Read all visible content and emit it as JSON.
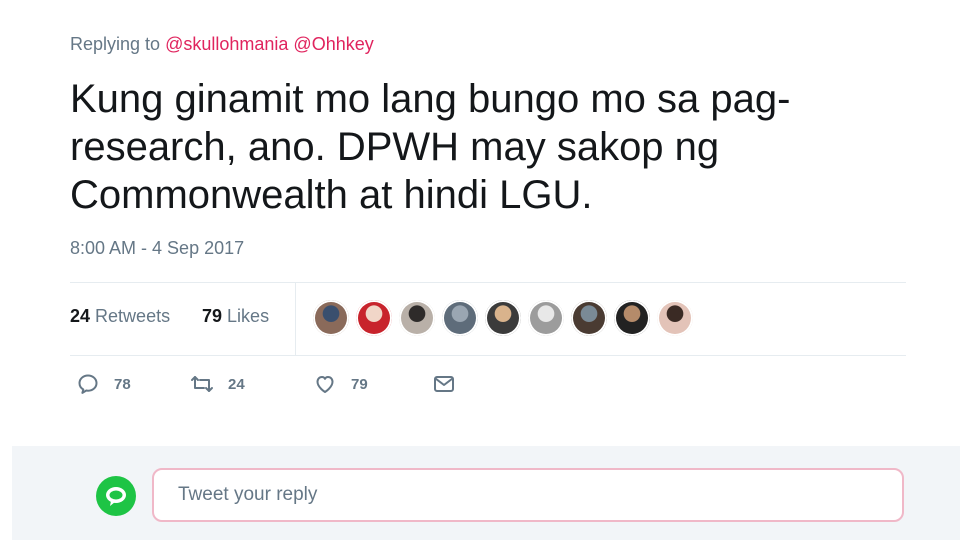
{
  "reply_context": {
    "prefix": "Replying to",
    "handles": [
      "@skullohmania",
      "@Ohhkey"
    ]
  },
  "tweet": {
    "text": "Kung ginamit mo lang bungo mo sa pag-\nresearch, ano. DPWH may sakop ng\nCommonwealth at hindi LGU.",
    "timestamp": "8:00 AM - 4 Sep 2017"
  },
  "stats": {
    "retweets_count": "24",
    "retweets_label": "Retweets",
    "likes_count": "79",
    "likes_label": "Likes"
  },
  "likers": [
    {
      "color": "#8a6a5a",
      "accent": "#3a4f6e"
    },
    {
      "color": "#c8232c",
      "accent": "#f1d6c8"
    },
    {
      "color": "#b9b0a8",
      "accent": "#2e2b2a"
    },
    {
      "color": "#5e6c7a",
      "accent": "#9aa6b2"
    },
    {
      "color": "#3b3b3b",
      "accent": "#d9b38c"
    },
    {
      "color": "#9c9c9c",
      "accent": "#e8e8e8"
    },
    {
      "color": "#4a3b32",
      "accent": "#7a8a96"
    },
    {
      "color": "#222222",
      "accent": "#b58b6a"
    },
    {
      "color": "#e3c3b8",
      "accent": "#3a2a24"
    }
  ],
  "actions": {
    "reply_count": "78",
    "retweet_count": "24",
    "like_count": "79"
  },
  "reply_box": {
    "placeholder": "Tweet your reply"
  },
  "colors": {
    "accent": "#e0245e",
    "muted": "#657786",
    "avatar_green": "#1ec445"
  }
}
